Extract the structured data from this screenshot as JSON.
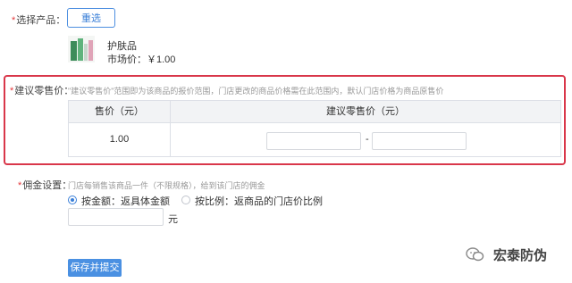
{
  "product": {
    "label_star": "*",
    "label": "选择产品：",
    "reselect_button": "重选",
    "name": "护肤品",
    "price_text": "市场价：￥1.00"
  },
  "suggested_price": {
    "label_star": "*",
    "label": "建议零售价：",
    "hint": "\"建议零售价\"范围即为该商品的报价范围，门店更改的商品价格需在此范围内，默认门店价格为商品原售价",
    "table": {
      "headers": [
        "售价（元）",
        "建议零售价（元）"
      ],
      "row": {
        "price": "1.00",
        "min_value": "",
        "separator": "-",
        "max_value": ""
      }
    },
    "highlight_color": "#d9374a"
  },
  "commission": {
    "label_star": "*",
    "label": "佣金设置：",
    "hint": "门店每销售该商品一件（不限规格），给到该门店的佣金",
    "options": [
      {
        "label": "按金额：返具体金额",
        "selected": true
      },
      {
        "label": "按比例：返商品的门店价比例",
        "selected": false
      }
    ],
    "amount_value": "",
    "unit": "元"
  },
  "submit_button": "保存并提交",
  "watermark": {
    "text": "宏泰防伪"
  },
  "colors": {
    "accent": "#4a90e2",
    "required": "#e4393c",
    "border": "#dcdfe6"
  }
}
